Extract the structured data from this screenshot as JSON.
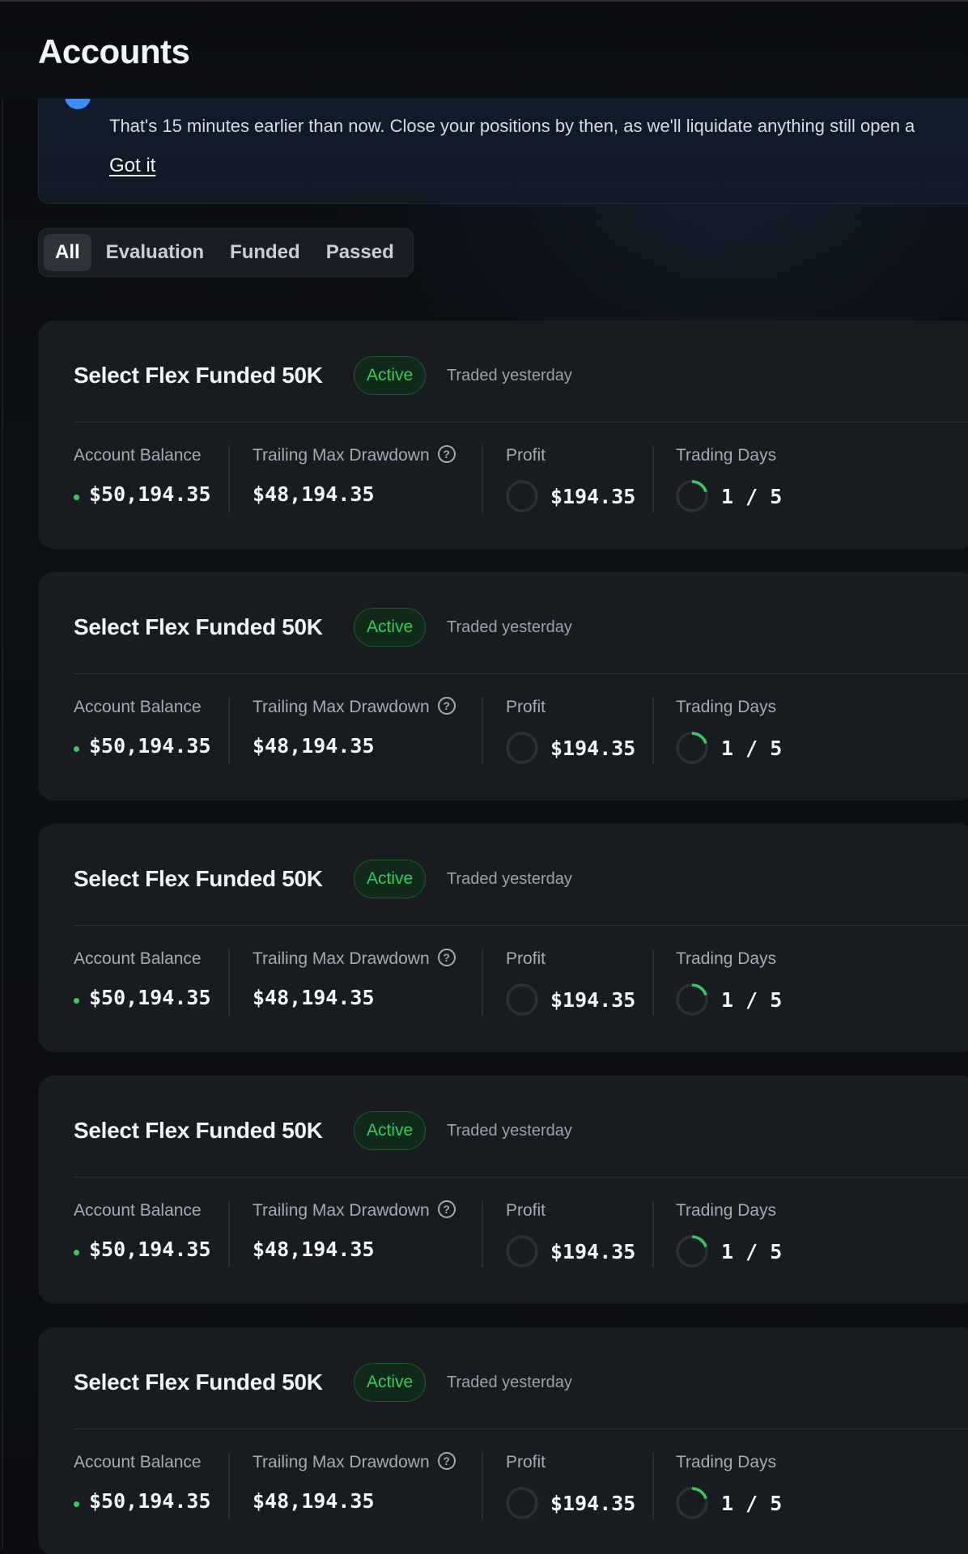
{
  "header": {
    "title": "Accounts"
  },
  "banner": {
    "message": "That's 15 minutes earlier than now. Close your positions by then, as we'll liquidate anything still open a",
    "dismiss_label": "Got it"
  },
  "tabs": [
    {
      "label": "All",
      "active": true
    },
    {
      "label": "Evaluation",
      "active": false
    },
    {
      "label": "Funded",
      "active": false
    },
    {
      "label": "Passed",
      "active": false
    }
  ],
  "colors": {
    "accent_green": "#2fcf5b",
    "info_blue": "#3b8ff6",
    "card_bg": "#181c21"
  },
  "accounts": [
    {
      "name": "Select Flex Funded 50K",
      "status": "Active",
      "last_traded": "Traded yesterday",
      "balance_label": "Account Balance",
      "balance": "$50,194.35",
      "drawdown_label": "Trailing Max Drawdown",
      "drawdown": "$48,194.35",
      "profit_label": "Profit",
      "profit": "$194.35",
      "profit_progress": 0,
      "days_label": "Trading Days",
      "days": "1 / 5",
      "days_progress": 0.2
    },
    {
      "name": "Select Flex Funded 50K",
      "status": "Active",
      "last_traded": "Traded yesterday",
      "balance_label": "Account Balance",
      "balance": "$50,194.35",
      "drawdown_label": "Trailing Max Drawdown",
      "drawdown": "$48,194.35",
      "profit_label": "Profit",
      "profit": "$194.35",
      "profit_progress": 0,
      "days_label": "Trading Days",
      "days": "1 / 5",
      "days_progress": 0.2
    },
    {
      "name": "Select Flex Funded 50K",
      "status": "Active",
      "last_traded": "Traded yesterday",
      "balance_label": "Account Balance",
      "balance": "$50,194.35",
      "drawdown_label": "Trailing Max Drawdown",
      "drawdown": "$48,194.35",
      "profit_label": "Profit",
      "profit": "$194.35",
      "profit_progress": 0,
      "days_label": "Trading Days",
      "days": "1 / 5",
      "days_progress": 0.2
    },
    {
      "name": "Select Flex Funded 50K",
      "status": "Active",
      "last_traded": "Traded yesterday",
      "balance_label": "Account Balance",
      "balance": "$50,194.35",
      "drawdown_label": "Trailing Max Drawdown",
      "drawdown": "$48,194.35",
      "profit_label": "Profit",
      "profit": "$194.35",
      "profit_progress": 0,
      "days_label": "Trading Days",
      "days": "1 / 5",
      "days_progress": 0.2
    },
    {
      "name": "Select Flex Funded 50K",
      "status": "Active",
      "last_traded": "Traded yesterday",
      "balance_label": "Account Balance",
      "balance": "$50,194.35",
      "drawdown_label": "Trailing Max Drawdown",
      "drawdown": "$48,194.35",
      "profit_label": "Profit",
      "profit": "$194.35",
      "profit_progress": 0,
      "days_label": "Trading Days",
      "days": "1 / 5",
      "days_progress": 0.2
    }
  ]
}
